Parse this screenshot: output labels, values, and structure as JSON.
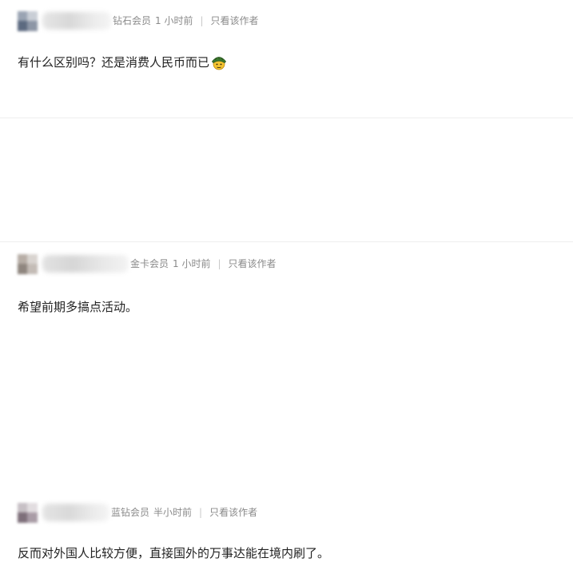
{
  "comments": [
    {
      "member_level": "钻石会员",
      "time": "1 小时前",
      "separator": "|",
      "author_only_label": "只看该作者",
      "text": "有什么区别吗？还是消费人民币而已",
      "emoji": "soldier-helmet-emoji"
    },
    {
      "member_level": "金卡会员",
      "time": "1 小时前",
      "separator": "|",
      "author_only_label": "只看该作者",
      "text": "希望前期多搞点活动。"
    },
    {
      "member_level": "蓝钻会员",
      "time": "半小时前",
      "separator": "|",
      "author_only_label": "只看该作者",
      "text": "反而对外国人比较方便，直接国外的万事达能在境内刷了。"
    }
  ],
  "colors": {
    "meta_text": "#8a8a8a",
    "body_text": "#222222",
    "divider": "#eeeeee"
  }
}
